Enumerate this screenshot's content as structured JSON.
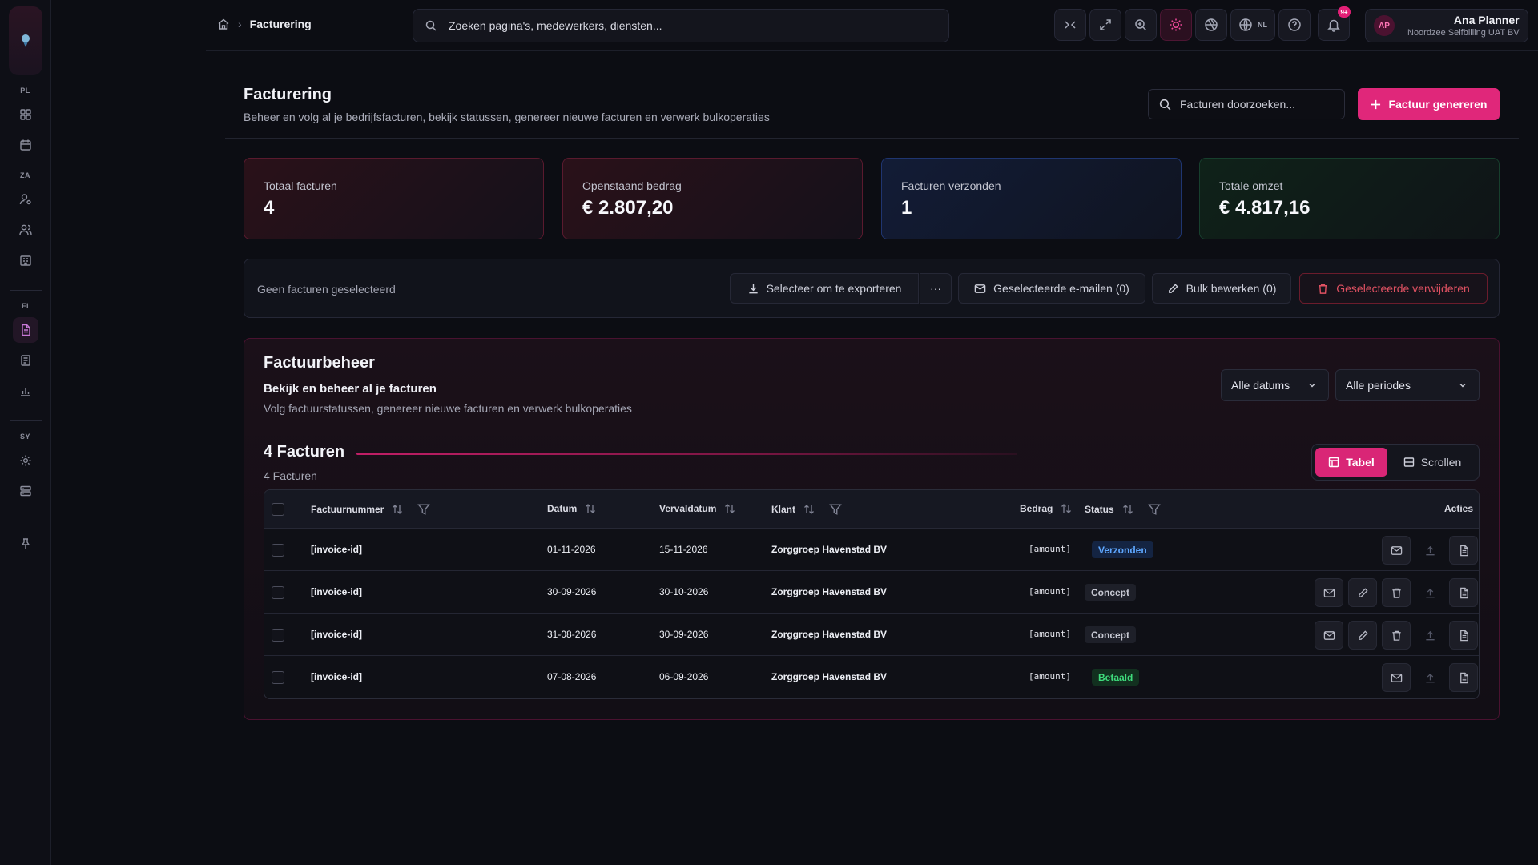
{
  "topbar": {
    "breadcrumb_current": "Facturering",
    "search_placeholder": "Zoeken pagina's, medewerkers, diensten...",
    "lang": "NL",
    "notification_count": "9+",
    "user": {
      "initials": "AP",
      "name": "Ana Planner",
      "org": "Noordzee Selfbilling UAT BV"
    }
  },
  "sidebar": {
    "sections": [
      "PL",
      "ZA",
      "FI",
      "SY"
    ]
  },
  "page": {
    "title": "Facturering",
    "subtitle": "Beheer en volg al je bedrijfsfacturen, bekijk statussen, genereer nieuwe facturen en verwerk bulkoperaties",
    "search_placeholder": "Facturen doorzoeken...",
    "generate_label": "Factuur genereren"
  },
  "stats": [
    {
      "label": "Totaal facturen",
      "value": "4"
    },
    {
      "label": "Openstaand bedrag",
      "value": "€ 2.807,20"
    },
    {
      "label": "Facturen verzonden",
      "value": "1"
    },
    {
      "label": "Totale omzet",
      "value": "€ 4.817,16"
    }
  ],
  "bulk": {
    "empty_text": "Geen facturen geselecteerd",
    "export_label": "Selecteer om te exporteren",
    "more_label": "···",
    "email_label": "Geselecteerde e-mailen (0)",
    "edit_label": "Bulk bewerken (0)",
    "delete_label": "Geselecteerde verwijderen"
  },
  "panel": {
    "title": "Factuurbeheer",
    "subtitle": "Bekijk en beheer al je facturen",
    "description": "Volg factuurstatussen, genereer nieuwe facturen en verwerk bulkoperaties",
    "date_filter": "Alle datums",
    "period_filter": "Alle periodes",
    "count_title": "4 Facturen",
    "count_sub": "4 Facturen",
    "view_table": "Tabel",
    "view_scroll": "Scrollen"
  },
  "table": {
    "headers": {
      "number": "Factuurnummer",
      "date": "Datum",
      "due": "Vervaldatum",
      "client": "Klant",
      "amount": "Bedrag",
      "status": "Status",
      "actions": "Acties"
    },
    "rows": [
      {
        "number": "[invoice-id]",
        "date": "01-11-2026",
        "due": "15-11-2026",
        "client": "Zorggroep Havenstad BV",
        "amount": "[amount]",
        "status": "Verzonden"
      },
      {
        "number": "[invoice-id]",
        "date": "30-09-2026",
        "due": "30-10-2026",
        "client": "Zorggroep Havenstad BV",
        "amount": "[amount]",
        "status": "Concept"
      },
      {
        "number": "[invoice-id]",
        "date": "31-08-2026",
        "due": "30-09-2026",
        "client": "Zorggroep Havenstad BV",
        "amount": "[amount]",
        "status": "Concept"
      },
      {
        "number": "[invoice-id]",
        "date": "07-08-2026",
        "due": "06-09-2026",
        "client": "Zorggroep Havenstad BV",
        "amount": "[amount]",
        "status": "Betaald"
      }
    ]
  },
  "colors": {
    "accent": "#e0277a",
    "status_sent": "#5ea7ff",
    "status_paid": "#3fdb7c",
    "danger": "#e05162"
  }
}
